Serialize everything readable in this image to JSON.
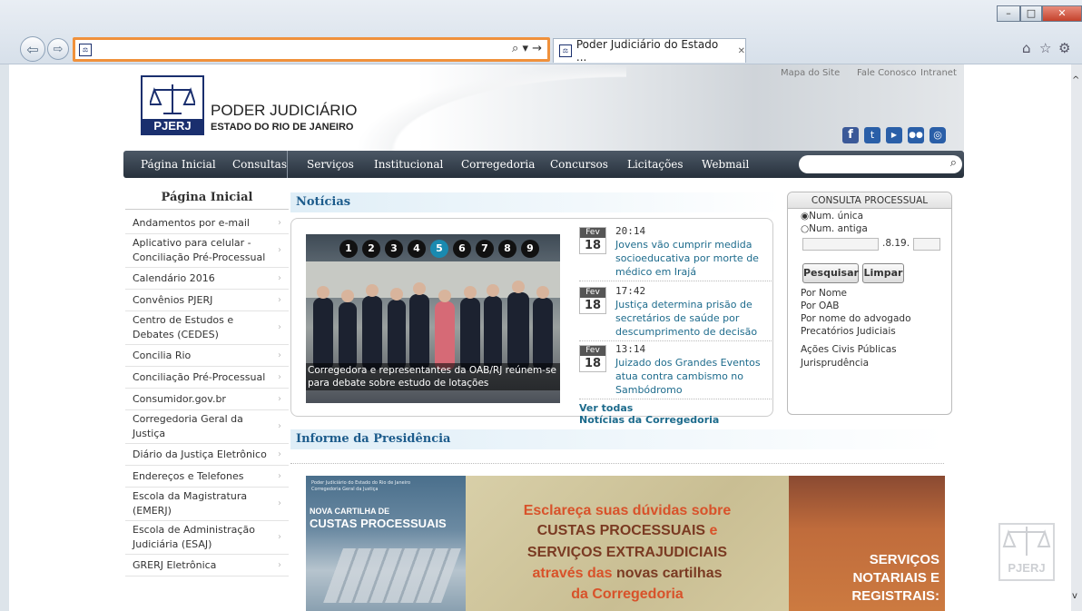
{
  "browser": {
    "tab_title": "Poder Judiciário do Estado ...",
    "tab_close": "✕",
    "search_glyph": "⌕ ▾ →",
    "window_controls": [
      "–",
      "□",
      "✕"
    ],
    "toolbar_icons": [
      "home-icon",
      "star-icon",
      "gear-icon"
    ]
  },
  "header": {
    "logo_text": "PJERJ",
    "title": "PODER JUDICIÁRIO",
    "subtitle": "ESTADO DO RIO DE JANEIRO",
    "top_links": [
      "Mapa do Site",
      "Fale Conosco",
      "Intranet"
    ],
    "social_icons": [
      "facebook-icon",
      "twitter-icon",
      "youtube-icon",
      "flickr-icon",
      "instagram-icon"
    ]
  },
  "nav": {
    "items": [
      "Página Inicial",
      "Consultas",
      "Serviços",
      "Institucional",
      "Corregedoria",
      "Concursos",
      "Licitações",
      "Webmail"
    ]
  },
  "sidebar": {
    "title": "Página Inicial",
    "items": [
      "Andamentos por e-mail",
      "Aplicativo para celular - Conciliação Pré-Processual",
      "Calendário 2016",
      "Convênios PJERJ",
      "Centro de Estudos e Debates (CEDES)",
      "Concilia Rio",
      "Conciliação Pré-Processual",
      "Consumidor.gov.br",
      "Corregedoria Geral da Justiça",
      "Diário da Justiça Eletrônico",
      "Endereços e Telefones",
      "Escola da Magistratura (EMERJ)",
      "Escola de Administração Judiciária (ESAJ)",
      "GRERJ Eletrônica"
    ]
  },
  "news": {
    "heading": "Notícias",
    "slider_numbers": [
      "1",
      "2",
      "3",
      "4",
      "5",
      "6",
      "7",
      "8",
      "9"
    ],
    "active_slide": "5",
    "caption": "Corregedora e representantes da OAB/RJ reúnem-se para debate sobre estudo de lotações",
    "items": [
      {
        "month": "Fev",
        "day": "18",
        "time": "20:14",
        "text": "Jovens vão cumprir medida socioeducativa por morte de médico em Irajá"
      },
      {
        "month": "Fev",
        "day": "18",
        "time": "17:42",
        "text": "Justiça determina prisão de secretários de saúde por descumprimento de decisão"
      },
      {
        "month": "Fev",
        "day": "18",
        "time": "13:14",
        "text": "Juizado dos Grandes Eventos atua contra cambismo no Sambódromo"
      }
    ],
    "see_all": "Ver todas",
    "corregedoria_link": "Notícias da Corregedoria"
  },
  "consulta": {
    "title": "CONSULTA PROCESSUAL",
    "opt1": "Num. única",
    "opt2": "Num. antiga",
    "mid_text": ".8.19.",
    "search_btn": "Pesquisar",
    "clear_btn": "Limpar",
    "links": [
      "Por Nome",
      "Por OAB",
      "Por nome do advogado",
      "Precatórios Judiciais"
    ],
    "links2": [
      "Ações Civis Públicas",
      "Jurisprudência"
    ]
  },
  "informe": {
    "heading": "Informe da Presidência"
  },
  "banner": {
    "small1": "Poder Judiciário do Estado do Rio de Janeiro",
    "small2": "Corregedoria Geral da Justiça",
    "left1": "NOVA CARTILHA DE",
    "left2": "CUSTAS PROCESSUAIS",
    "line1": "Esclareça suas dúvidas sobre",
    "line2a": "CUSTAS PROCESSUAIS",
    "line2b": " e",
    "line3": "SERVIÇOS EXTRAJUDICIAIS",
    "line4a": "através das ",
    "line4b": "novas cartilhas",
    "line5": "da Corregedoria",
    "right1": "SERVIÇOS",
    "right2": "NOTARIAIS E",
    "right3": "REGISTRAIS:"
  },
  "watermark": "PJERJ"
}
